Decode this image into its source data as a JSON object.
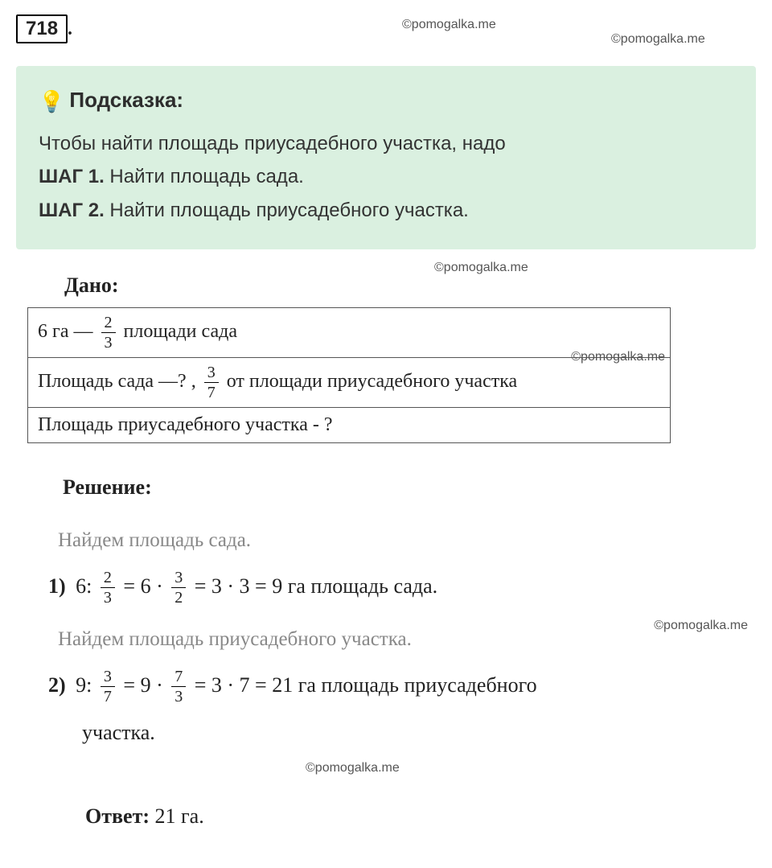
{
  "problem_number": "718",
  "watermarks": {
    "w1": "©pomogalka.me",
    "w2": "©pomogalka.me",
    "w3": "©pomogalka.me",
    "w4": "©pomogalka.me",
    "w5": "©pomogalka.me",
    "w6": "©pomogalka.me"
  },
  "hint": {
    "title": "Подсказка:",
    "intro": "Чтобы найти площадь приусадебного участка, надо",
    "steps": [
      {
        "label": "ШАГ 1.",
        "text": "Найти площадь сада."
      },
      {
        "label": "ШАГ 2.",
        "text": "Найти площадь приусадебного участка."
      }
    ]
  },
  "given": {
    "title": "Дано:",
    "rows": {
      "r1": {
        "pre": "6 га —",
        "frac_num": "2",
        "frac_den": "3",
        "post": " площади сада"
      },
      "r2": {
        "pre": "Площадь сада —? ,",
        "frac_num": "3",
        "frac_den": "7",
        "post": "от площади приусадебного участка"
      },
      "r3": {
        "text": "Площадь приусадебного участка - ?"
      }
    }
  },
  "solution": {
    "title": "Решение:",
    "note1": "Найдем площадь сада.",
    "step1": {
      "idx": "1)",
      "a": "6:",
      "f1n": "2",
      "f1d": "3",
      "mid1": " = 6 · ",
      "f2n": "3",
      "f2d": "2",
      "mid2": " = 3 · 3 = 9 га  площадь сада."
    },
    "note2": "Найдем площадь приусадебного участка.",
    "step2": {
      "idx": "2)",
      "a": "9:",
      "f1n": "3",
      "f1d": "7",
      "mid1": " = 9 · ",
      "f2n": "7",
      "f2d": "3",
      "mid2": " = 3 · 7 = 21 га площадь приусадебного",
      "cont": "участка."
    },
    "answer_label": "Ответ:",
    "answer_text": "  21 га."
  }
}
